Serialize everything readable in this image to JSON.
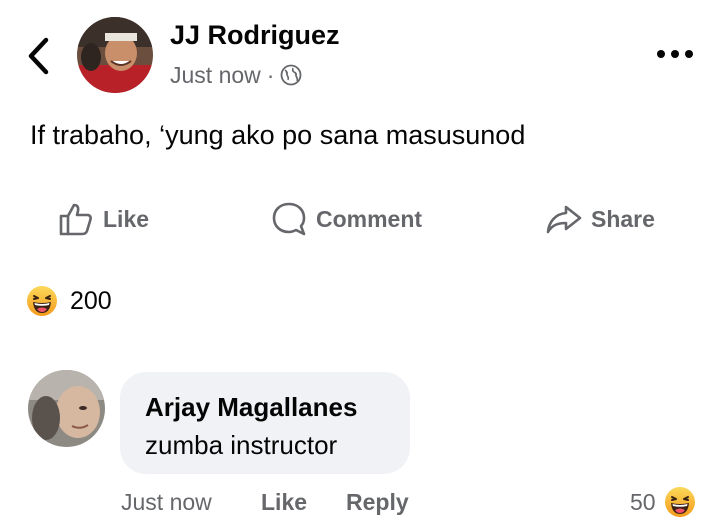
{
  "post": {
    "author": "JJ Rodriguez",
    "timestamp": "Just now",
    "separator": "·",
    "audience_icon": "globe-icon",
    "text": "If trabaho, ‘yung ako po sana masusunod"
  },
  "actions": {
    "like_label": "Like",
    "comment_label": "Comment",
    "share_label": "Share"
  },
  "reactions": {
    "icon": "haha-emoji-icon",
    "count": "200"
  },
  "comment": {
    "author": "Arjay Magallanes",
    "text": "zumba instructor",
    "timestamp": "Just now",
    "like_label": "Like",
    "reply_label": "Reply",
    "reaction_count": "50",
    "reaction_icon": "haha-emoji-icon"
  },
  "colors": {
    "text_primary": "#050505",
    "text_secondary": "#65676b",
    "bubble_bg": "#f0f2f5",
    "emoji_yellow": "#f7b125"
  }
}
